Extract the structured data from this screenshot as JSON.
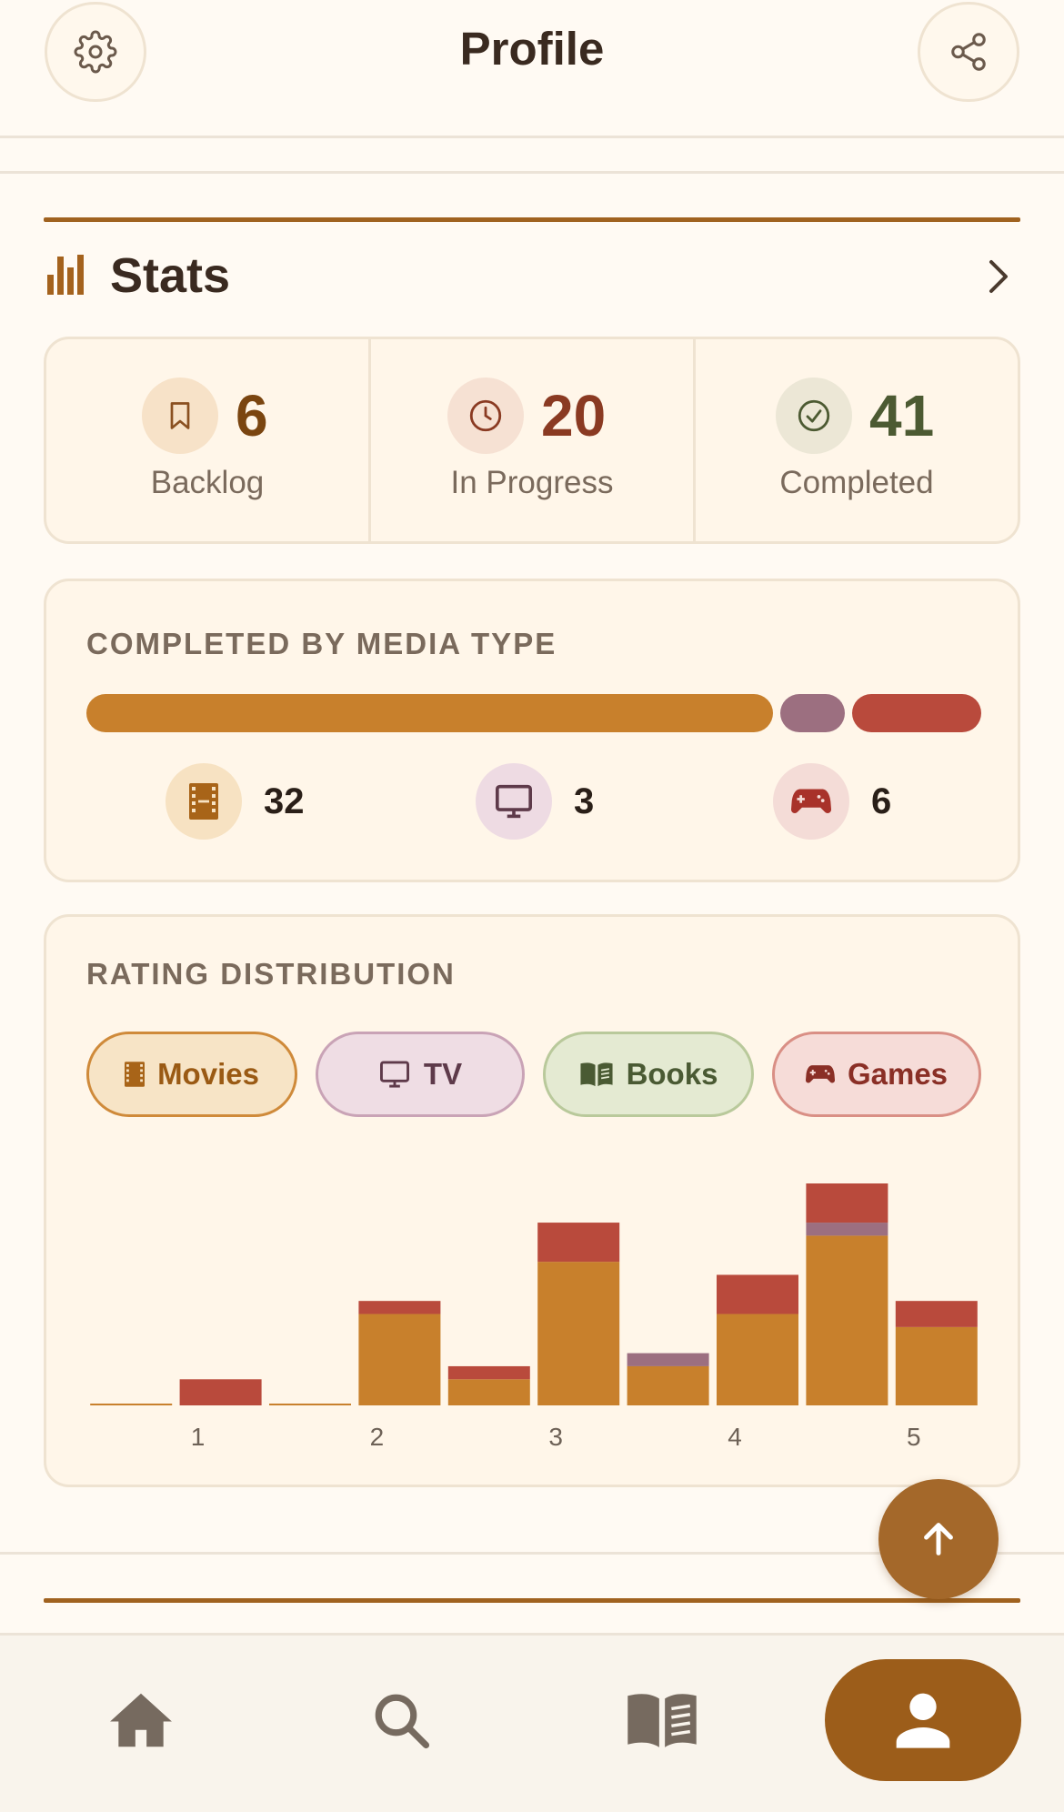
{
  "header": {
    "title": "Profile",
    "settings_icon": "gear-icon",
    "share_icon": "share-icon"
  },
  "stats": {
    "title": "Stats",
    "icon": "bar-chart-icon",
    "more_icon": "chevron-right-icon",
    "summary": [
      {
        "key": "backlog",
        "value": "6",
        "label": "Backlog",
        "icon": "bookmark-icon",
        "color": "#7a4510",
        "bg": "#f7e2c8"
      },
      {
        "key": "in_progress",
        "value": "20",
        "label": "In Progress",
        "icon": "clock-icon",
        "color": "#8a3a22",
        "bg": "#f6e1d3"
      },
      {
        "key": "completed",
        "value": "41",
        "label": "Completed",
        "icon": "check-circle-icon",
        "color": "#4c5a32",
        "bg": "#ece7d6"
      }
    ]
  },
  "media_type": {
    "label": "COMPLETED BY MEDIA TYPE",
    "items": [
      {
        "key": "movies",
        "value": "32",
        "count": 32,
        "icon": "film-icon",
        "color": "#c8802c",
        "bg": "#f7e2c2"
      },
      {
        "key": "tv",
        "value": "3",
        "count": 3,
        "icon": "tv-icon",
        "color": "#9c6f80",
        "bg": "#eedbe3"
      },
      {
        "key": "games",
        "value": "6",
        "count": 6,
        "icon": "gamepad-icon",
        "color": "#b94a3c",
        "bg": "#f4dcd7"
      }
    ]
  },
  "rating": {
    "label": "RATING DISTRIBUTION",
    "chips": [
      {
        "key": "movies",
        "label": "Movies",
        "icon": "film-icon",
        "color": "#9a5a14",
        "bg": "#f7e4c6",
        "border": "#cf8a3a"
      },
      {
        "key": "tv",
        "label": "TV",
        "icon": "tv-icon",
        "color": "#5e3a4a",
        "bg": "#efdde4",
        "border": "#c9a3b6"
      },
      {
        "key": "books",
        "label": "Books",
        "icon": "book-icon",
        "color": "#4a5a33",
        "bg": "#e4ead2",
        "border": "#b9c99b"
      },
      {
        "key": "games",
        "label": "Games",
        "icon": "gamepad-icon",
        "color": "#8a2f26",
        "bg": "#f6dcd8",
        "border": "#d98f85"
      }
    ]
  },
  "chart_data": {
    "type": "bar",
    "stacked": true,
    "categories": [
      "0.5",
      "1",
      "1.5",
      "2",
      "2.5",
      "3",
      "3.5",
      "4",
      "4.5",
      "5"
    ],
    "tick_labels": [
      "",
      "1",
      "",
      "2",
      "",
      "3",
      "",
      "4",
      "",
      "5"
    ],
    "series": [
      {
        "name": "Movies",
        "color": "#c8802c",
        "values": [
          0,
          0,
          0,
          7,
          2,
          11,
          3,
          7,
          13,
          6
        ]
      },
      {
        "name": "TV",
        "color": "#9c6f80",
        "values": [
          0,
          0,
          0,
          0,
          0,
          0,
          1,
          0,
          1,
          0
        ]
      },
      {
        "name": "Games",
        "color": "#b94a3c",
        "values": [
          0,
          2,
          0,
          1,
          1,
          3,
          0,
          3,
          3,
          2
        ]
      }
    ],
    "ylim": [
      0,
      17
    ],
    "grid": false
  },
  "nav": {
    "items": [
      {
        "key": "home",
        "icon": "home-icon"
      },
      {
        "key": "search",
        "icon": "search-icon"
      },
      {
        "key": "library",
        "icon": "book-open-icon"
      },
      {
        "key": "profile",
        "icon": "person-icon",
        "active": true
      }
    ]
  },
  "fab": {
    "icon": "arrow-up-icon"
  }
}
